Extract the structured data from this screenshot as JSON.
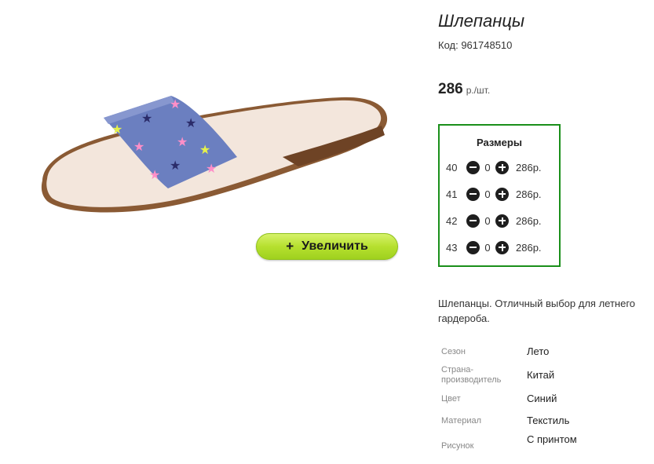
{
  "product": {
    "title": "Шлепанцы",
    "code": "Код: 961748510",
    "price": "286",
    "price_unit": "р./шт.",
    "zoom_label": "Увеличить",
    "zoom_icon": "+"
  },
  "sizes": {
    "title": "Размеры",
    "rows": [
      {
        "size": "40",
        "qty": "0",
        "price": "286р."
      },
      {
        "size": "41",
        "qty": "0",
        "price": "286р."
      },
      {
        "size": "42",
        "qty": "0",
        "price": "286р."
      },
      {
        "size": "43",
        "qty": "0",
        "price": "286р."
      }
    ]
  },
  "description": "Шлепанцы. Отличный выбор для летнего гардероба.",
  "attributes": [
    {
      "label": "Сезон",
      "value": "Лето"
    },
    {
      "label": "Страна-производитель",
      "value": "Китай"
    },
    {
      "label": "Цвет",
      "value": "Синий"
    },
    {
      "label": "Материал",
      "value": "Текстиль"
    },
    {
      "label": "Рисунок",
      "value": "С принтом"
    }
  ],
  "colors": {
    "accent_border": "#1a8f1a",
    "button_green": "#b6e02f",
    "strap_blue": "#6b7fc0"
  }
}
